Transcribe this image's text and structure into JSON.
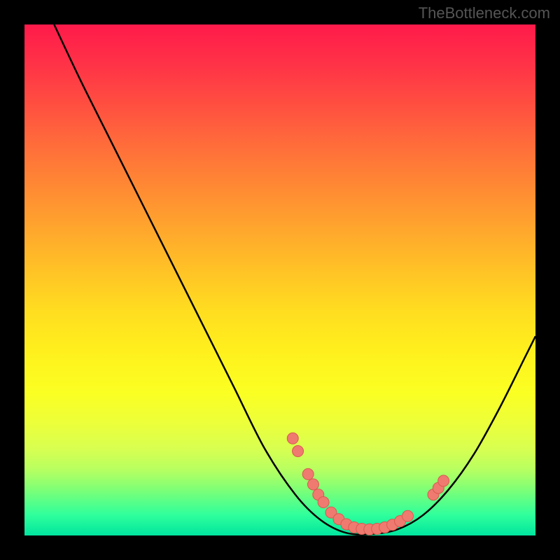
{
  "attribution": "TheBottleneck.com",
  "chart_data": {
    "type": "line",
    "title": "",
    "xlabel": "",
    "ylabel": "",
    "xlim": [
      0,
      100
    ],
    "ylim": [
      0,
      100
    ],
    "curve": [
      {
        "x": 5.8,
        "y": 100
      },
      {
        "x": 11,
        "y": 89
      },
      {
        "x": 17,
        "y": 77
      },
      {
        "x": 23,
        "y": 65
      },
      {
        "x": 29,
        "y": 53
      },
      {
        "x": 35,
        "y": 41
      },
      {
        "x": 41,
        "y": 29
      },
      {
        "x": 47,
        "y": 17
      },
      {
        "x": 53,
        "y": 8
      },
      {
        "x": 58,
        "y": 3
      },
      {
        "x": 63,
        "y": 0.5
      },
      {
        "x": 68,
        "y": 0.3
      },
      {
        "x": 73,
        "y": 1.2
      },
      {
        "x": 78,
        "y": 4
      },
      {
        "x": 83,
        "y": 9
      },
      {
        "x": 88,
        "y": 16
      },
      {
        "x": 93,
        "y": 25
      },
      {
        "x": 98,
        "y": 35
      },
      {
        "x": 100,
        "y": 39
      }
    ],
    "dot_clusters": [
      {
        "x": 52.5,
        "y": 19
      },
      {
        "x": 53.5,
        "y": 16.5
      },
      {
        "x": 55.5,
        "y": 12
      },
      {
        "x": 56.5,
        "y": 10
      },
      {
        "x": 57.5,
        "y": 8
      },
      {
        "x": 58.5,
        "y": 6.5
      },
      {
        "x": 60.0,
        "y": 4.5
      },
      {
        "x": 61.5,
        "y": 3.2
      },
      {
        "x": 63.0,
        "y": 2.2
      },
      {
        "x": 64.5,
        "y": 1.6
      },
      {
        "x": 66.0,
        "y": 1.3
      },
      {
        "x": 67.5,
        "y": 1.2
      },
      {
        "x": 69.0,
        "y": 1.3
      },
      {
        "x": 70.5,
        "y": 1.6
      },
      {
        "x": 72.0,
        "y": 2.1
      },
      {
        "x": 73.5,
        "y": 2.8
      },
      {
        "x": 75.0,
        "y": 3.8
      },
      {
        "x": 80.0,
        "y": 8.0
      },
      {
        "x": 81.0,
        "y": 9.3
      },
      {
        "x": 82.0,
        "y": 10.7
      }
    ],
    "colors": {
      "curve": "#000000",
      "dot_fill": "#ef7a70",
      "dot_stroke": "#d85a50"
    }
  }
}
